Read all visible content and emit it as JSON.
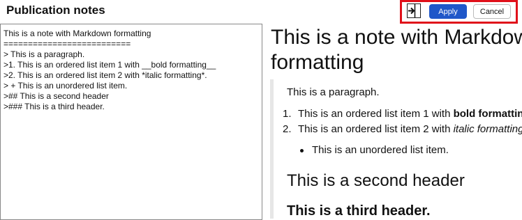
{
  "header": {
    "title": "Publication notes",
    "apply_label": "Apply",
    "cancel_label": "Cancel",
    "collapse_icon": "collapse-panel-icon"
  },
  "editor": {
    "text": "This is a note with Markdown formatting\n==========================\n> This is a paragraph.\n>1. This is an ordered list item 1 with __bold formatting__\n>2. This is an ordered list item 2 with *italic formatting*.\n> + This is an unordered list item.\n>## This is a second header\n>### This is a third header."
  },
  "preview": {
    "h1": "This is a note with Markdown\nformatting",
    "paragraph": "This is a paragraph.",
    "ol": [
      {
        "num": "1.",
        "text": "This is an ordered list item 1 with ",
        "emph": "bold formatting"
      },
      {
        "num": "2.",
        "text": "This is an ordered list item 2 with ",
        "emph": "italic formatting"
      }
    ],
    "ul": [
      "This is an unordered list item."
    ],
    "h2": "This is a second header",
    "h3": "This is a third header."
  },
  "colors": {
    "accent": "#1f57c9",
    "highlight": "#e0101a"
  }
}
